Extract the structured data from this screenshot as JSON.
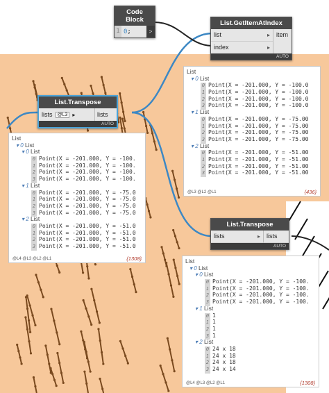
{
  "colors": {
    "canvas": "#f7c89b",
    "wire": "#3d88c4",
    "node_bg": "#3c3c3c",
    "selected": "#4aa3d8",
    "stick": "#7a4a1f"
  },
  "code_block": {
    "title": "Code Block",
    "line_no": "1",
    "code_num": "0",
    "code_rest": ";",
    "out": ">"
  },
  "get_item": {
    "title": "List.GetItemAtIndex",
    "in_list": "list",
    "in_index": "index",
    "out_item": "item",
    "auto": "AUTO"
  },
  "transpose1": {
    "title": "List.Transpose",
    "in_lists": "lists",
    "level": "@L3",
    "out_lists": "lists",
    "auto": "AUTO"
  },
  "transpose2": {
    "title": "List.Transpose",
    "in_lists": "lists",
    "out_lists": "lists",
    "auto": "AUTO"
  },
  "preview_get": {
    "root": "List",
    "groups": [
      {
        "idx": "0",
        "label": "List",
        "items": [
          {
            "i": "0",
            "v": "Point(X = -201.000, Y = -100.0"
          },
          {
            "i": "1",
            "v": "Point(X = -201.000, Y = -100.0"
          },
          {
            "i": "2",
            "v": "Point(X = -201.000, Y = -100.0"
          },
          {
            "i": "3",
            "v": "Point(X = -201.000, Y = -100.0"
          }
        ]
      },
      {
        "idx": "1",
        "label": "List",
        "items": [
          {
            "i": "0",
            "v": "Point(X = -201.000, Y = -75.00"
          },
          {
            "i": "1",
            "v": "Point(X = -201.000, Y = -75.00"
          },
          {
            "i": "2",
            "v": "Point(X = -201.000, Y = -75.00"
          },
          {
            "i": "3",
            "v": "Point(X = -201.000, Y = -75.00"
          }
        ]
      },
      {
        "idx": "2",
        "label": "List",
        "items": [
          {
            "i": "0",
            "v": "Point(X = -201.000, Y = -51.00"
          },
          {
            "i": "1",
            "v": "Point(X = -201.000, Y = -51.00"
          },
          {
            "i": "2",
            "v": "Point(X = -201.000, Y = -51.00"
          },
          {
            "i": "3",
            "v": "Point(X = -201.000, Y = -51.00"
          }
        ]
      }
    ],
    "levels": "@L3 @L2 @L1",
    "count": "{436}"
  },
  "preview_t1": {
    "root": "List",
    "top_idx": "0",
    "top_label": "List",
    "groups": [
      {
        "idx": "0",
        "label": "List",
        "items": [
          {
            "i": "0",
            "v": "Point(X = -201.000, Y = -100."
          },
          {
            "i": "1",
            "v": "Point(X = -201.000, Y = -100."
          },
          {
            "i": "2",
            "v": "Point(X = -201.000, Y = -100."
          },
          {
            "i": "3",
            "v": "Point(X = -201.000, Y = -100."
          }
        ]
      },
      {
        "idx": "1",
        "label": "List",
        "items": [
          {
            "i": "0",
            "v": "Point(X = -201.000, Y = -75.0"
          },
          {
            "i": "1",
            "v": "Point(X = -201.000, Y = -75.0"
          },
          {
            "i": "2",
            "v": "Point(X = -201.000, Y = -75.0"
          },
          {
            "i": "3",
            "v": "Point(X = -201.000, Y = -75.0"
          }
        ]
      },
      {
        "idx": "2",
        "label": "List",
        "items": [
          {
            "i": "0",
            "v": "Point(X = -201.000, Y = -51.0"
          },
          {
            "i": "1",
            "v": "Point(X = -201.000, Y = -51.0"
          },
          {
            "i": "2",
            "v": "Point(X = -201.000, Y = -51.0"
          },
          {
            "i": "3",
            "v": "Point(X = -201.000, Y = -51.0"
          }
        ]
      }
    ],
    "levels": "@L4 @L3 @L2 @L1",
    "count": "{1308}"
  },
  "preview_t2": {
    "root": "List",
    "top_idx": "0",
    "top_label": "List",
    "groups": [
      {
        "idx": "0",
        "label": "List",
        "items": [
          {
            "i": "0",
            "v": "Point(X = -201.000, Y = -100."
          },
          {
            "i": "1",
            "v": "Point(X = -201.000, Y = -100."
          },
          {
            "i": "2",
            "v": "Point(X = -201.000, Y = -100."
          },
          {
            "i": "3",
            "v": "Point(X = -201.000, Y = -100."
          }
        ]
      },
      {
        "idx": "1",
        "label": "List",
        "items": [
          {
            "i": "0",
            "v": "1"
          },
          {
            "i": "1",
            "v": "1"
          },
          {
            "i": "2",
            "v": "1"
          },
          {
            "i": "3",
            "v": "1"
          }
        ]
      },
      {
        "idx": "2",
        "label": "List",
        "items": [
          {
            "i": "0",
            "v": "24 x 18"
          },
          {
            "i": "1",
            "v": "24 x 18"
          },
          {
            "i": "2",
            "v": "24 x 18"
          },
          {
            "i": "3",
            "v": "24 x 14"
          }
        ]
      }
    ],
    "levels": "@L4 @L3 @L2 @L1",
    "count": "{1308}"
  }
}
